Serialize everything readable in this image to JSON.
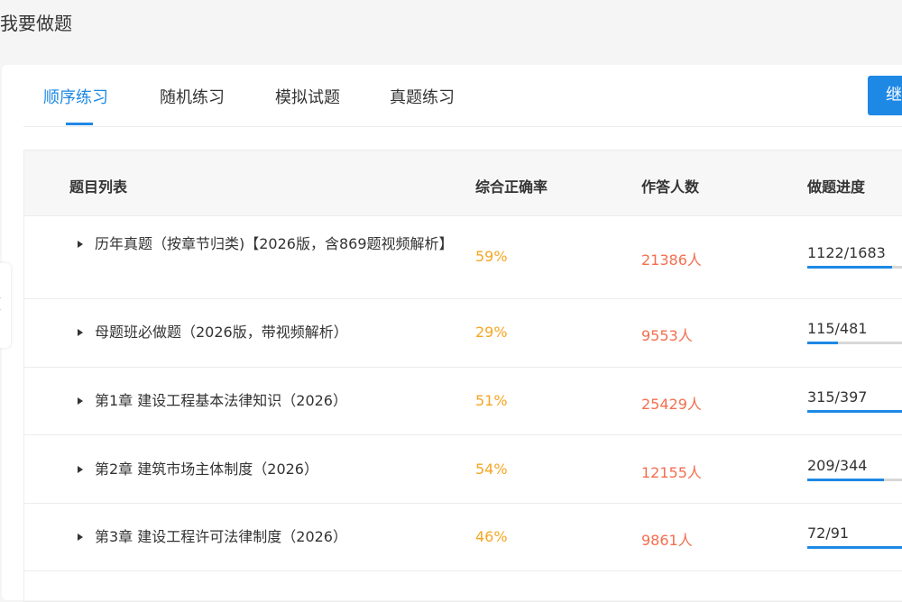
{
  "page_title": "我要做题",
  "tabs": [
    {
      "label": "顺序练习",
      "active": true
    },
    {
      "label": "随机练习",
      "active": false
    },
    {
      "label": "模拟试题",
      "active": false
    },
    {
      "label": "真题练习",
      "active": false
    }
  ],
  "continue_button": "继",
  "table": {
    "headers": {
      "list": "题目列表",
      "accuracy": "综合正确率",
      "respondents": "作答人数",
      "progress": "做题进度"
    },
    "rows": [
      {
        "name": "历年真题（按章节归类)【2026版，含869题视频解析】",
        "accuracy": "59%",
        "respondents": "21386人",
        "progress_text": "1122/1683",
        "progress_fraction": 0.67
      },
      {
        "name": "母题班必做题（2026版，带视频解析）",
        "accuracy": "29%",
        "respondents": "9553人",
        "progress_text": "115/481",
        "progress_fraction": 0.24
      },
      {
        "name": "第1章 建设工程基本法律知识（2026）",
        "accuracy": "51%",
        "respondents": "25429人",
        "progress_text": "315/397",
        "progress_fraction": 0.79
      },
      {
        "name": "第2章 建筑市场主体制度（2026）",
        "accuracy": "54%",
        "respondents": "12155人",
        "progress_text": "209/344",
        "progress_fraction": 0.61
      },
      {
        "name": "第3章 建设工程许可法律制度（2026）",
        "accuracy": "46%",
        "respondents": "9861人",
        "progress_text": "72/91",
        "progress_fraction": 0.79
      }
    ]
  },
  "colors": {
    "accent": "#1e88e5",
    "rate": "#f5a623",
    "count": "#f26f4f"
  },
  "icons": {
    "row_toggle": "caret-right-icon",
    "side_collapse": "chevron-left-icon"
  }
}
